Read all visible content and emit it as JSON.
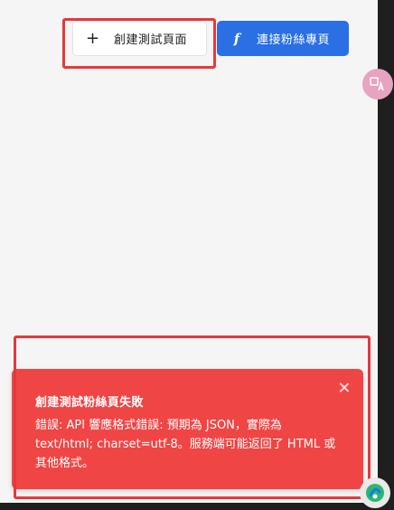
{
  "toolbar": {
    "create_test_page_label": "創建測試頁面",
    "create_test_page_icon": "plus-icon",
    "connect_fan_page_label": "連接粉絲專頁",
    "connect_fan_page_icon": "facebook-icon",
    "connect_fan_page_color": "#2a6fe3"
  },
  "error_toast": {
    "title": "創建測試粉絲頁失敗",
    "message": "錯誤: API 響應格式錯誤: 預期為 JSON，實際為 text/html; charset=utf-8。服務端可能返回了 HTML 或其他格式。",
    "close_icon": "close-icon",
    "color": "#f04545"
  },
  "floating": {
    "translate_icon": "translate-icon",
    "assistant_icon": "assistant-icon"
  },
  "highlight_color": "#e5383b"
}
